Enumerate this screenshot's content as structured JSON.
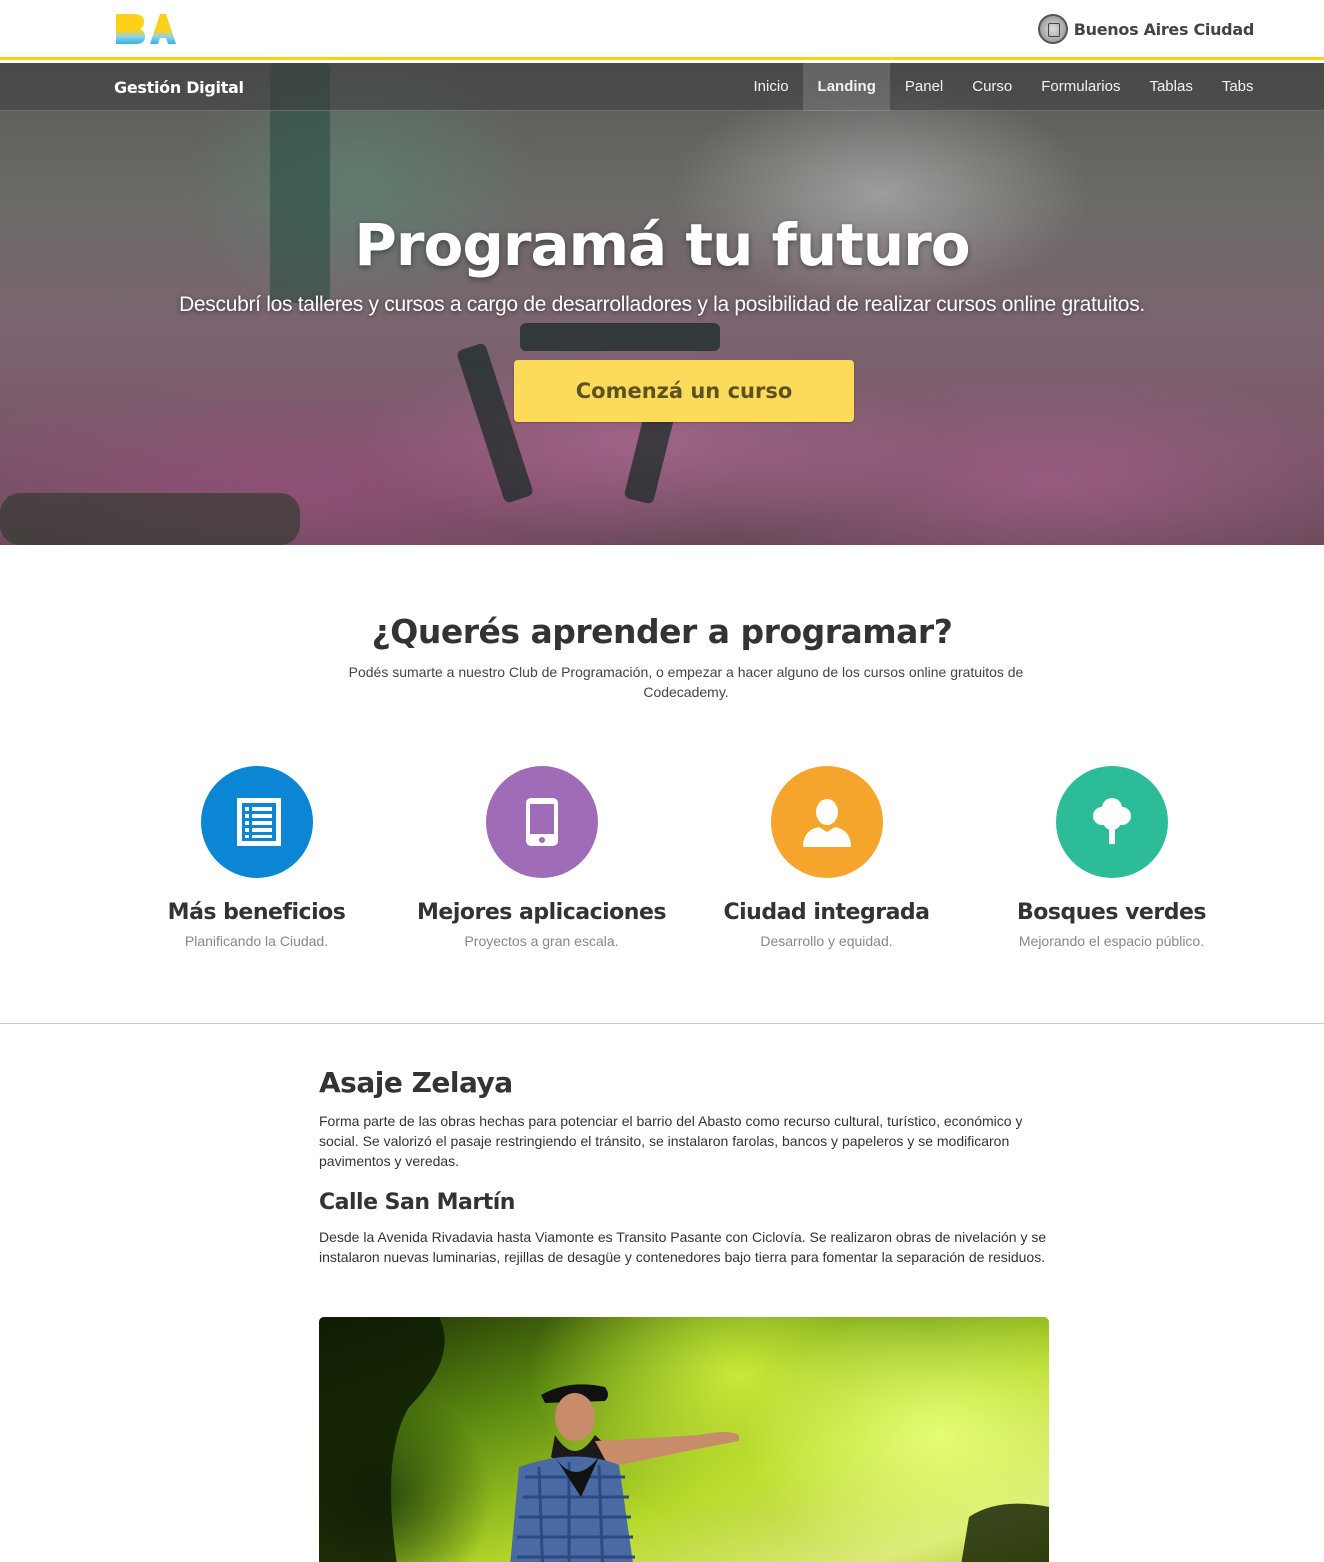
{
  "header": {
    "logo_text": "BA",
    "city_logo_text": "Buenos Aires Ciudad"
  },
  "navbar": {
    "brand": "Gestión Digital",
    "links": [
      {
        "label": "Inicio",
        "active": false
      },
      {
        "label": "Landing",
        "active": true
      },
      {
        "label": "Panel",
        "active": false
      },
      {
        "label": "Curso",
        "active": false
      },
      {
        "label": "Formularios",
        "active": false
      },
      {
        "label": "Tablas",
        "active": false
      },
      {
        "label": "Tabs",
        "active": false
      }
    ]
  },
  "hero": {
    "title": "Programá tu futuro",
    "subtitle": "Descubrí los talleres y cursos a cargo de desarrolladores y la posibilidad de realizar cursos online gratuitos.",
    "cta_label": "Comenzá un curso"
  },
  "intro": {
    "title": "¿Querés aprender a programar?",
    "description": "Podés sumarte a nuestro Club de Programación, o empezar a hacer alguno de los cursos online gratuitos de Codecademy."
  },
  "features": [
    {
      "title": "Más beneficios",
      "subtitle": "Planificando la Ciudad.",
      "icon": "list-icon",
      "color": "#0b86d4"
    },
    {
      "title": "Mejores aplicaciones",
      "subtitle": "Proyectos a gran escala.",
      "icon": "mobile-phone-icon",
      "color": "#a06cb8"
    },
    {
      "title": "Ciudad integrada",
      "subtitle": "Desarrollo y equidad.",
      "icon": "user-icon",
      "color": "#f5a52b"
    },
    {
      "title": "Bosques verdes",
      "subtitle": "Mejorando el espacio público.",
      "icon": "tree-icon",
      "color": "#2dbc98"
    }
  ],
  "articles": [
    {
      "title": "Asaje Zelaya",
      "body": "Forma parte de las obras hechas para potenciar el barrio del Abasto como recurso cultural, turístico, económico y social. Se valorizó el pasaje restringiendo el tránsito, se instalaron farolas, bancos y papeleros y se modificaron pavimentos y veredas."
    },
    {
      "title": "Calle San Martín",
      "body": "Desde la Avenida Rivadavia hasta Viamonte es Transito Pasante con Ciclovía. Se realizaron obras de nivelación y se instalaron nuevas luminarias, rejillas de desagüe y contenedores bajo tierra para fomentar la separación de residuos."
    }
  ],
  "colors": {
    "accent_yellow": "#fdd306",
    "button_yellow": "#fddb5a"
  }
}
